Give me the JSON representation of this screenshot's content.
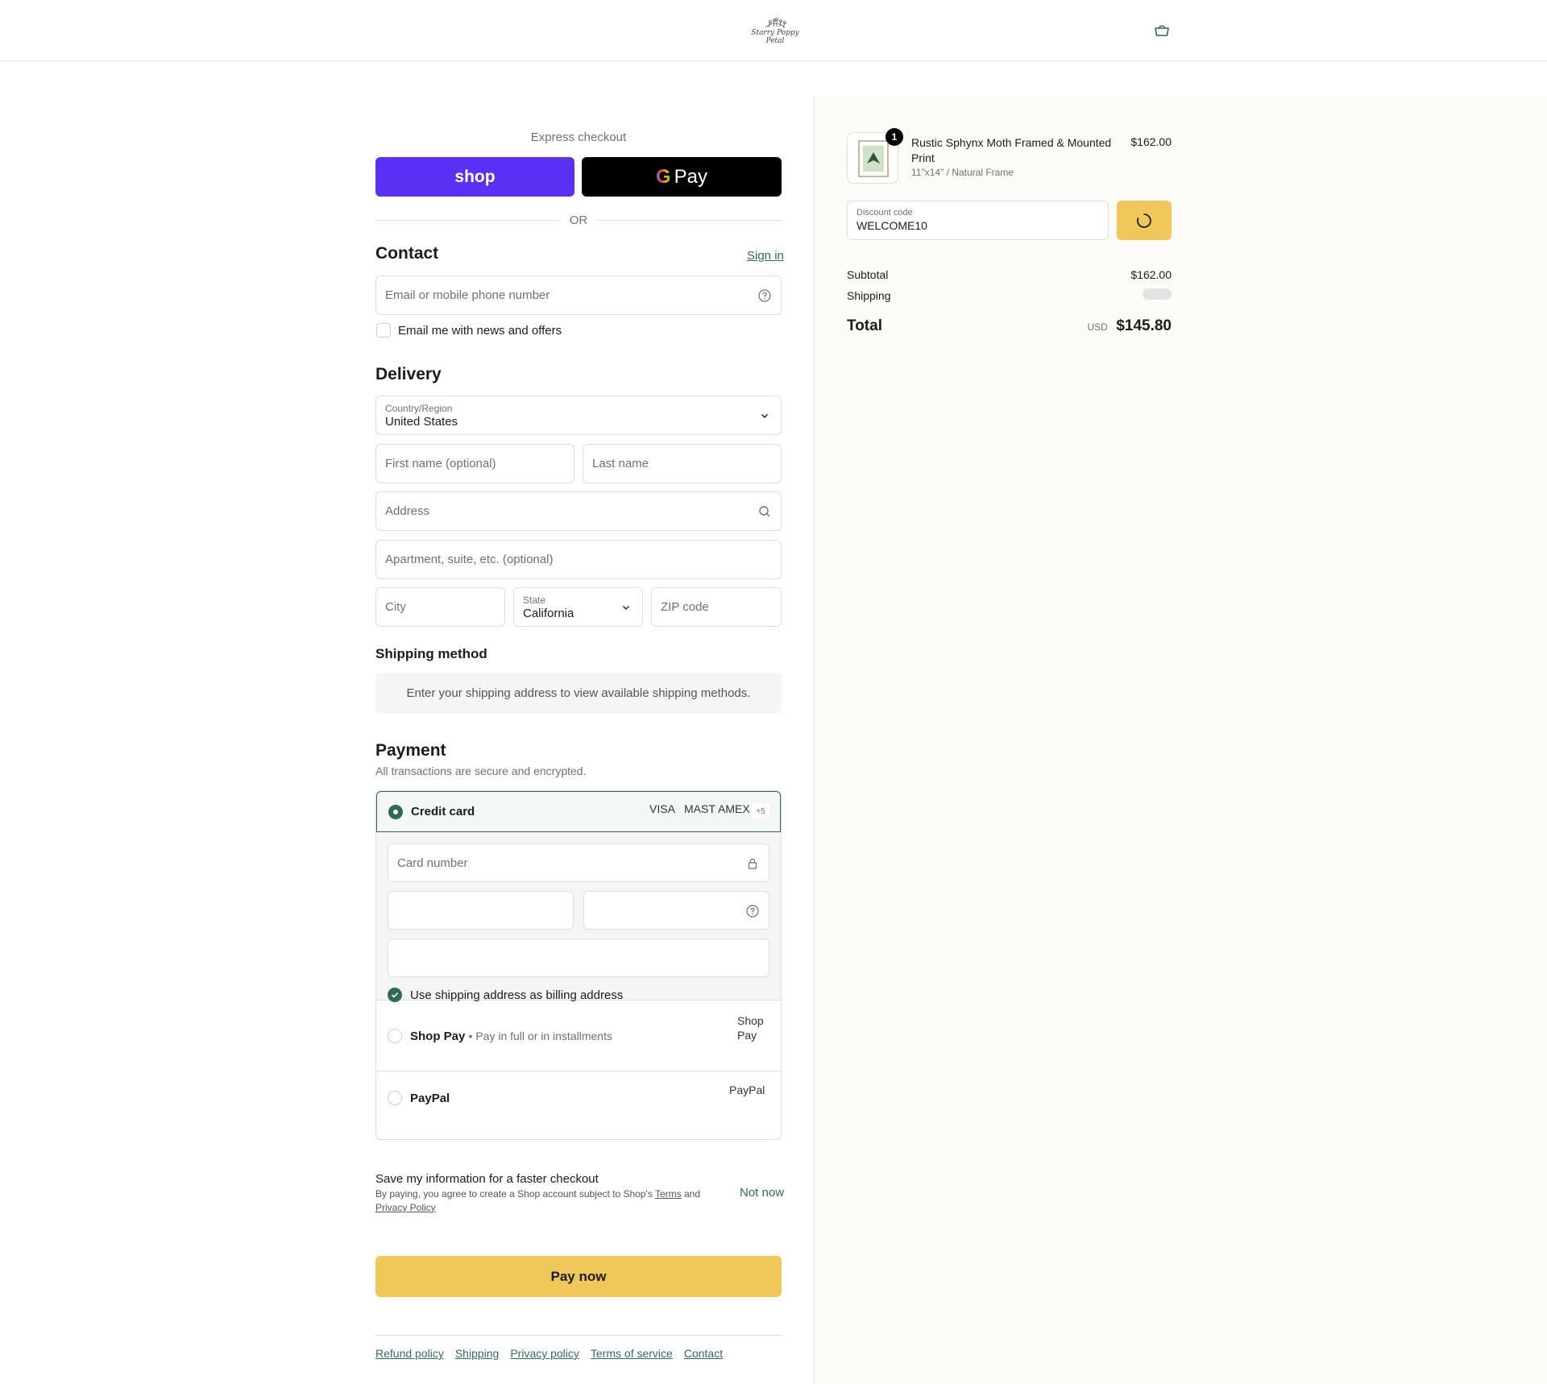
{
  "header": {
    "logo_text": "Starry Poppy Petal"
  },
  "express": {
    "label": "Express checkout",
    "shop_label": "shop",
    "gpay_g": "G",
    "gpay_label": "Pay",
    "or": "OR"
  },
  "contact": {
    "title": "Contact",
    "sign_in": "Sign in",
    "email_placeholder": "Email or mobile phone number",
    "news_label": "Email me with news and offers"
  },
  "delivery": {
    "title": "Delivery",
    "country_label": "Country/Region",
    "country_value": "United States",
    "first_name_placeholder": "First name (optional)",
    "last_name_placeholder": "Last name",
    "address_placeholder": "Address",
    "apartment_placeholder": "Apartment, suite, etc. (optional)",
    "city_placeholder": "City",
    "state_label": "State",
    "state_value": "California",
    "zip_placeholder": "ZIP code"
  },
  "shipping": {
    "title": "Shipping method",
    "notice": "Enter your shipping address to view available shipping methods."
  },
  "payment": {
    "title": "Payment",
    "subtitle": "All transactions are secure and encrypted.",
    "credit_card_label": "Credit card",
    "brand_visa": "VISA",
    "brand_master": "MASTER",
    "brand_amex": "AMEX",
    "brand_more": "+5",
    "card_number_placeholder": "Card number",
    "billing_label": "Use shipping address as billing address",
    "shop_pay_label": "Shop Pay",
    "shop_pay_desc": "Pay in full or in installments",
    "shop_pay_img": "Shop Pay",
    "paypal_label": "PayPal",
    "paypal_img": "PayPal"
  },
  "save_info": {
    "title": "Save my information for a faster checkout",
    "desc_prefix": "By paying, you agree to create a Shop account subject to Shop's ",
    "terms": "Terms",
    "and": " and",
    "privacy": "Privacy Policy",
    "not_now": "Not now"
  },
  "pay_button": "Pay now",
  "footer": {
    "links": [
      "Refund policy",
      "Shipping",
      "Privacy policy",
      "Terms of service",
      "Contact"
    ]
  },
  "summary": {
    "product_name": "Rustic Sphynx Moth Framed & Mounted Print",
    "product_variant": "11\"x14\" / Natural Frame",
    "product_price": "$162.00",
    "quantity": "1",
    "discount_label": "Discount code",
    "discount_value": "WELCOME10",
    "subtotal_label": "Subtotal",
    "subtotal_value": "$162.00",
    "shipping_label": "Shipping",
    "total_label": "Total",
    "currency": "USD",
    "total_value": "$145.80"
  },
  "colors": {
    "accent": "#316a4f",
    "shop_purple": "#5a31f4",
    "pay_yellow": "#f0c85a",
    "sidebar_bg": "#fdfbf7"
  }
}
